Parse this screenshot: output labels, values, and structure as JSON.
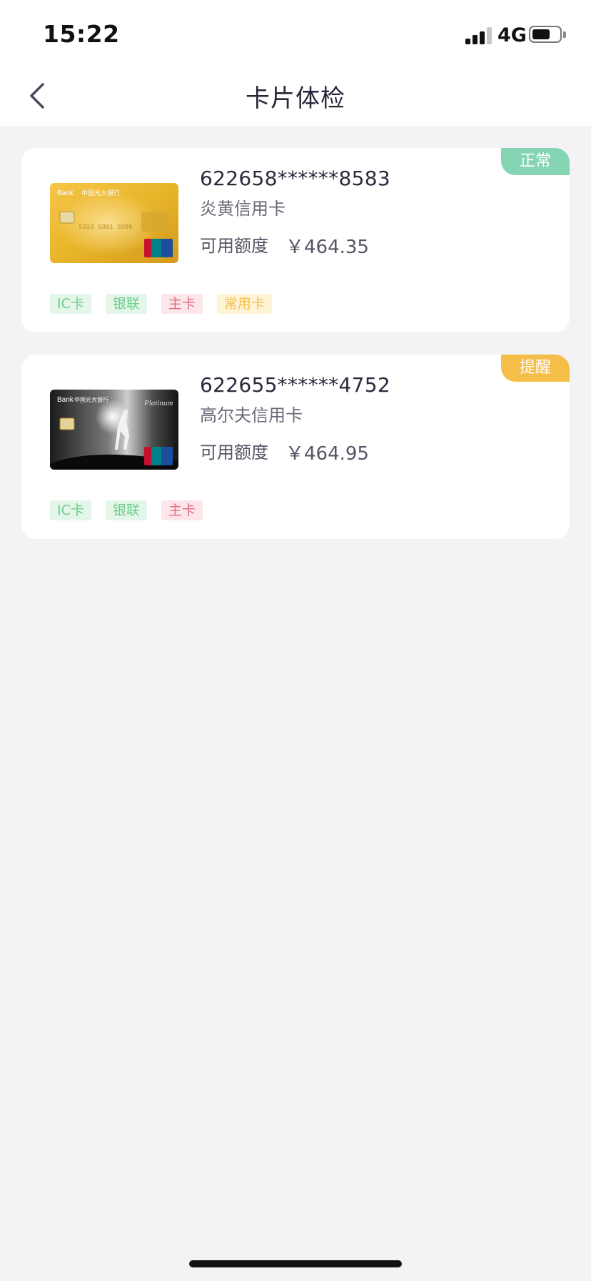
{
  "status_bar": {
    "time": "15:22",
    "network": "4G",
    "battery_level": 0.62
  },
  "nav": {
    "title": "卡片体检",
    "back_icon": "chevron-left-icon"
  },
  "cards": [
    {
      "number": "622658******8583",
      "name": "炎黄信用卡",
      "limit_label": "可用额度",
      "limit_value": "￥464.35",
      "status": "正常",
      "status_color": "#85d4b3",
      "image_style": "gold",
      "tags": [
        {
          "label": "IC卡",
          "style": "green"
        },
        {
          "label": "银联",
          "style": "green"
        },
        {
          "label": "主卡",
          "style": "red"
        },
        {
          "label": "常用卡",
          "style": "yellow"
        }
      ]
    },
    {
      "number": "622655******4752",
      "name": "高尔夫信用卡",
      "limit_label": "可用额度",
      "limit_value": "￥464.95",
      "status": "提醒",
      "status_color": "#f4be49",
      "image_style": "black-golf",
      "tags": [
        {
          "label": "IC卡",
          "style": "green"
        },
        {
          "label": "银联",
          "style": "green"
        },
        {
          "label": "主卡",
          "style": "red"
        }
      ]
    }
  ]
}
